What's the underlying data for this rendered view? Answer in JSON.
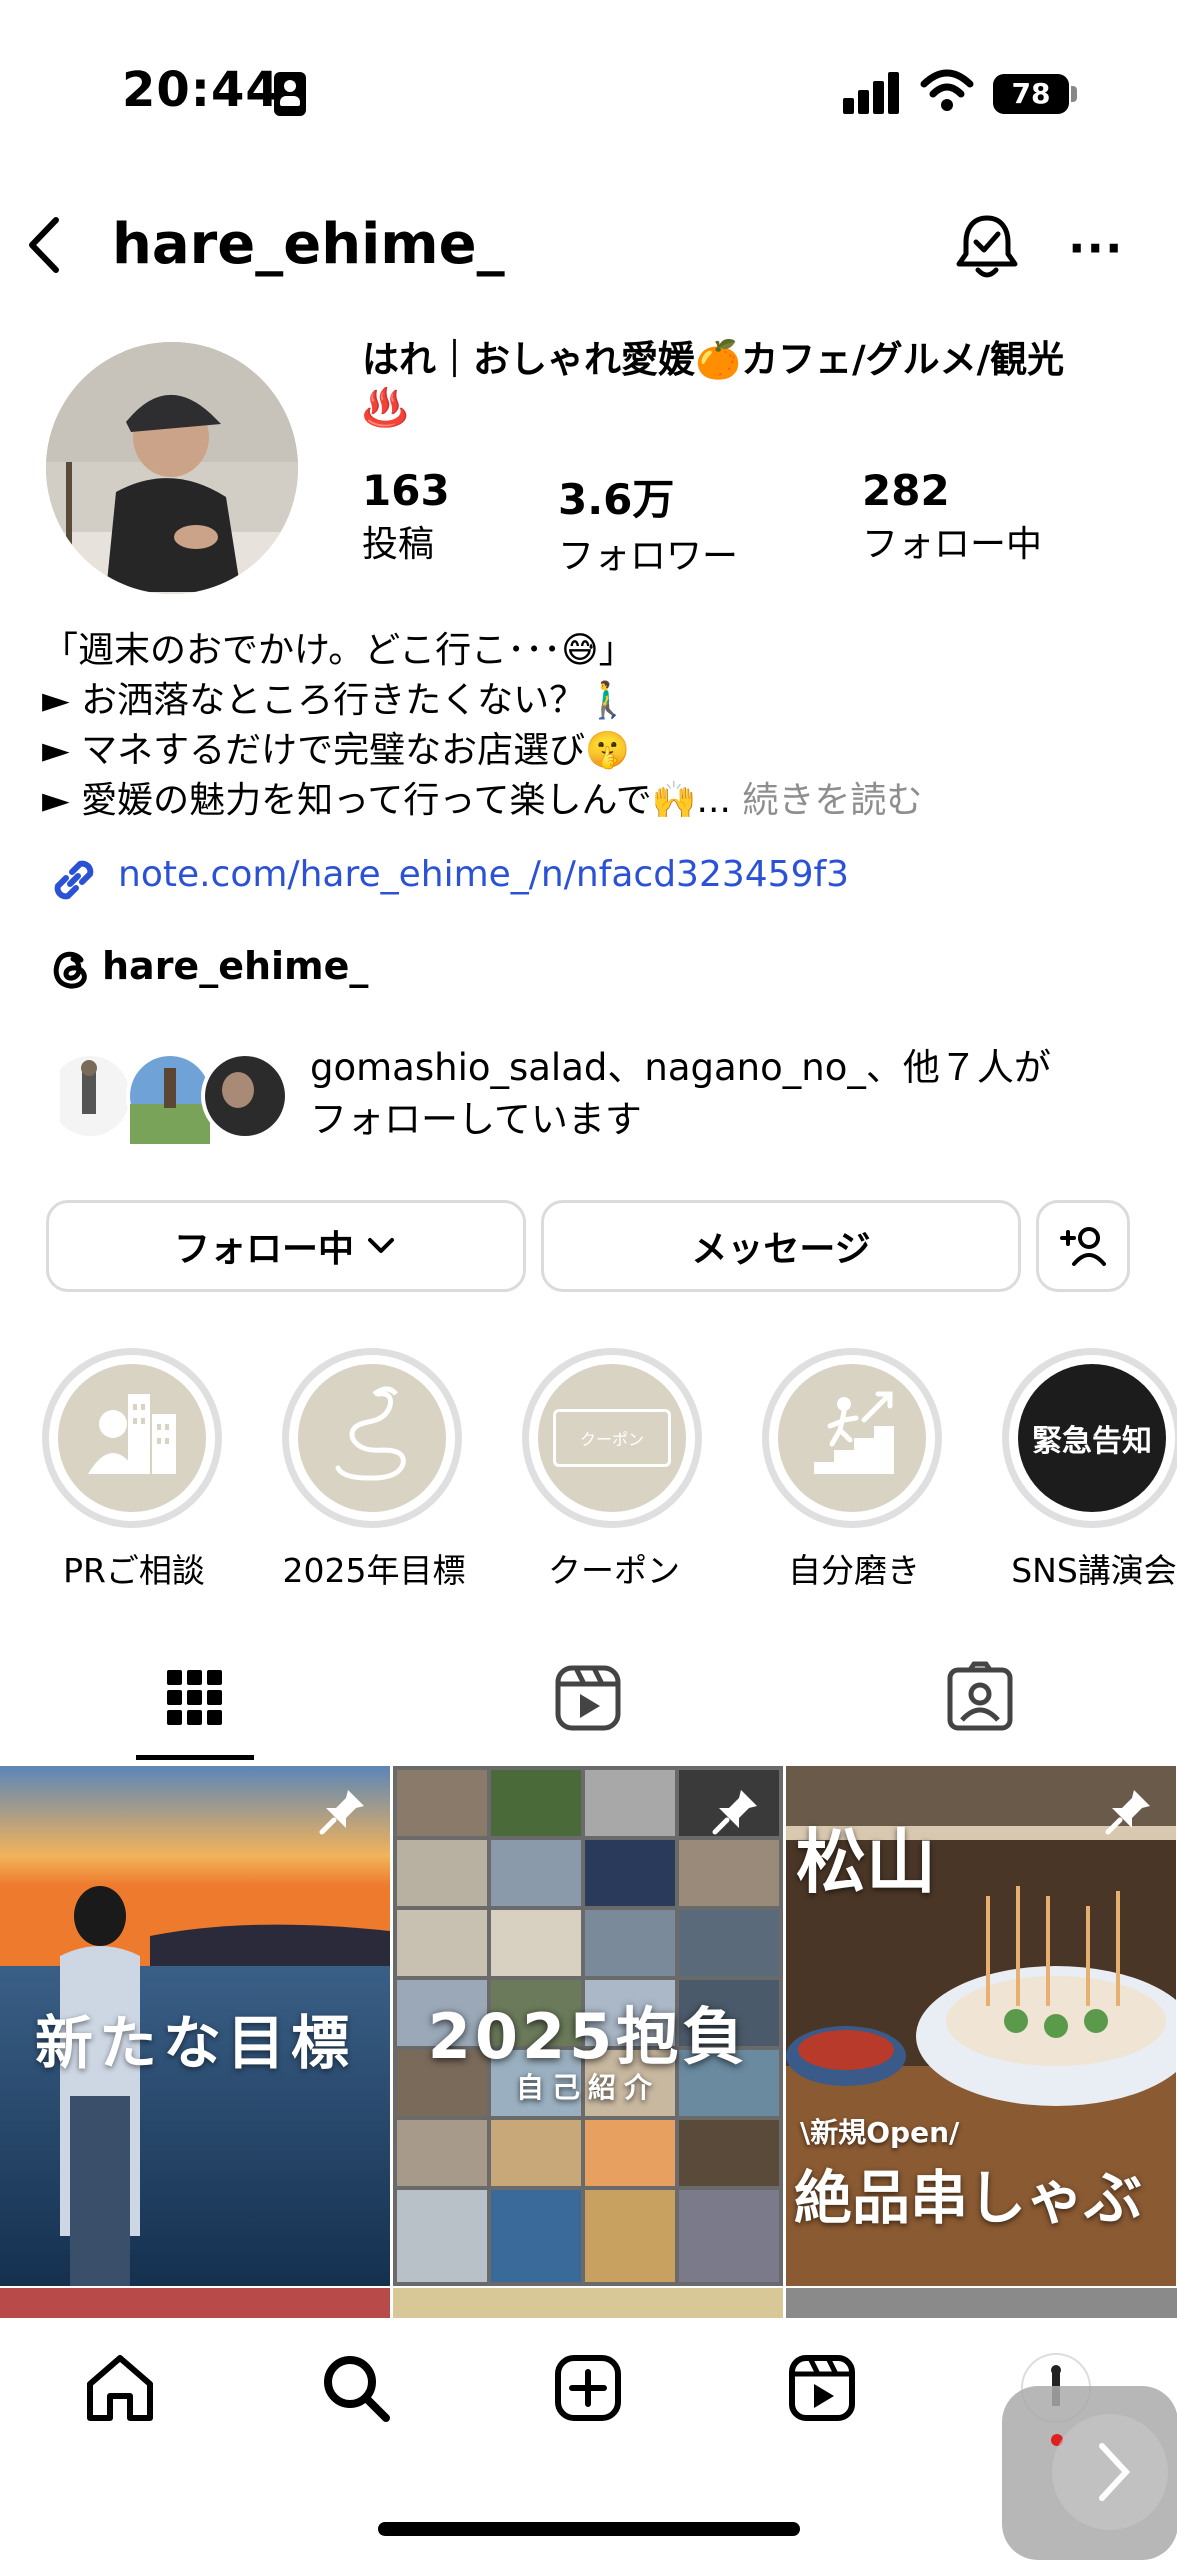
{
  "status_bar": {
    "time": "20:44",
    "battery": "78"
  },
  "header": {
    "username": "hare_ehime_"
  },
  "profile": {
    "display_name_line1": "はれ｜おしゃれ愛媛🍊カフェ/グルメ/観光",
    "display_name_line2": "♨️",
    "stats": [
      {
        "value": "163",
        "label": "投稿"
      },
      {
        "value": "3.6万",
        "label": "フォロワー"
      },
      {
        "value": "282",
        "label": "フォロー中"
      }
    ],
    "bio_lines": [
      "「週末のおでかけ。どこ行こ･･･😅」",
      "► お洒落なところ行きたくない？🚶‍♂️",
      "► マネするだけで完璧なお店選び🤫",
      "► 愛媛の魅力を知って行って楽しんで🙌..."
    ],
    "bio_more": "続きを読む",
    "link": "note.com/hare_ehime_/n/nfacd323459f3",
    "threads_handle": "hare_ehime_",
    "followed_by_line1": "gomashio_salad、nagano_no_、他７人が",
    "followed_by_line2": "フォローしています"
  },
  "buttons": {
    "following": "フォロー中",
    "message": "メッセージ"
  },
  "highlights": [
    {
      "label": "PRご相談",
      "icon": "business-person-icon"
    },
    {
      "label": "2025年目標",
      "icon": "snake-icon"
    },
    {
      "label": "クーポン",
      "icon": "coupon-icon",
      "inner_text": "クーポン"
    },
    {
      "label": "自分磨き",
      "icon": "stairs-climb-icon"
    },
    {
      "label": "SNS講演会",
      "icon": "emergency-notice",
      "inner_text": "緊急告知"
    }
  ],
  "tabs": [
    "grid",
    "reels",
    "tagged"
  ],
  "posts": [
    {
      "overlay": "新たな目標",
      "pinned": true
    },
    {
      "overlay": "2025抱負",
      "sub": "自己紹介",
      "pinned": true
    },
    {
      "overlay_top": "松山",
      "tag": "\\新規Open/",
      "overlay": "絶品串しゃぶ",
      "pinned": true
    }
  ],
  "colors": {
    "link": "#2b52d6",
    "muted": "#8e8e8e",
    "highlight_bg": "#d8d3c3",
    "border": "#dbdbdb"
  }
}
